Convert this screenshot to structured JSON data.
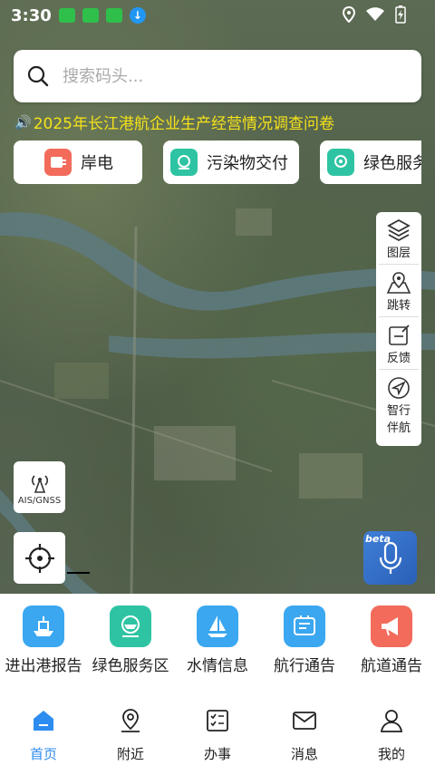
{
  "status_bar": {
    "time": "3:30"
  },
  "search": {
    "placeholder": "搜索码头..."
  },
  "notice": {
    "text": "2025年长江港航企业生产经营情况调查问卷"
  },
  "chips": [
    {
      "label": "岸电",
      "icon": "power-plug-icon",
      "color": "#f26b5b"
    },
    {
      "label": "污染物交付",
      "icon": "pollution-icon",
      "color": "#2ec4a3"
    },
    {
      "label": "绿色服务",
      "icon": "green-service-icon",
      "color": "#2ec4a3"
    }
  ],
  "map_tools": [
    {
      "label": "图层",
      "icon": "layers-icon"
    },
    {
      "label": "跳转",
      "icon": "map-pin-icon"
    },
    {
      "label": "反馈",
      "icon": "feedback-icon"
    },
    {
      "label": "智行伴航",
      "icon": "navigation-icon"
    }
  ],
  "ais": {
    "label": "AIS/GNSS"
  },
  "voice": {
    "badge": "beta"
  },
  "services": [
    {
      "label": "进出港报告",
      "icon": "ship-report-icon",
      "color": "#3aa7f0"
    },
    {
      "label": "绿色服务区",
      "icon": "green-ship-icon",
      "color": "#2ec4a3"
    },
    {
      "label": "水情信息",
      "icon": "sailboat-icon",
      "color": "#3aa7f0"
    },
    {
      "label": "航行通告",
      "icon": "notice-board-icon",
      "color": "#3aa7f0"
    },
    {
      "label": "航道通告",
      "icon": "megaphone-icon",
      "color": "#f26b5b"
    }
  ],
  "tabs": [
    {
      "label": "首页",
      "icon": "home-icon",
      "active": true
    },
    {
      "label": "附近",
      "icon": "location-icon",
      "active": false
    },
    {
      "label": "办事",
      "icon": "tasks-icon",
      "active": false
    },
    {
      "label": "消息",
      "icon": "mail-icon",
      "active": false
    },
    {
      "label": "我的",
      "icon": "user-icon",
      "active": false
    }
  ],
  "colors": {
    "accent": "#2d8cf0",
    "notice": "#f5e21a"
  }
}
